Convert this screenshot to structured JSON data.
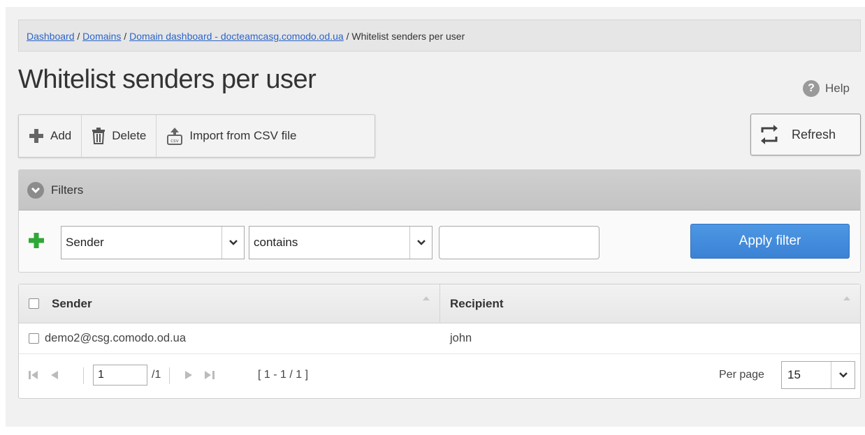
{
  "breadcrumb": {
    "items": [
      "Dashboard",
      "Domains",
      "Domain dashboard - docteamcasg.comodo.od.ua"
    ],
    "separator": " / ",
    "current": "Whitelist senders per user"
  },
  "page_title": "Whitelist senders per user",
  "help_label": "Help",
  "toolbar": {
    "add_label": "Add",
    "delete_label": "Delete",
    "import_label": "Import from CSV file"
  },
  "refresh_label": "Refresh",
  "filters": {
    "header": "Filters",
    "field_select": "Sender",
    "operator_select": "contains",
    "value_input": "",
    "apply_label": "Apply filter"
  },
  "table": {
    "columns": [
      "Sender",
      "Recipient"
    ],
    "rows": [
      {
        "sender": "demo2@csg.comodo.od.ua",
        "recipient": "john"
      }
    ]
  },
  "pager": {
    "page": "1",
    "total_pages": "/1",
    "range": "[ 1 - 1 / 1 ]",
    "per_page_label": "Per page",
    "per_page_value": "15"
  },
  "colors": {
    "accent_blue": "#3f88d8",
    "add_green": "#2ea836",
    "link": "#2a64c8"
  }
}
